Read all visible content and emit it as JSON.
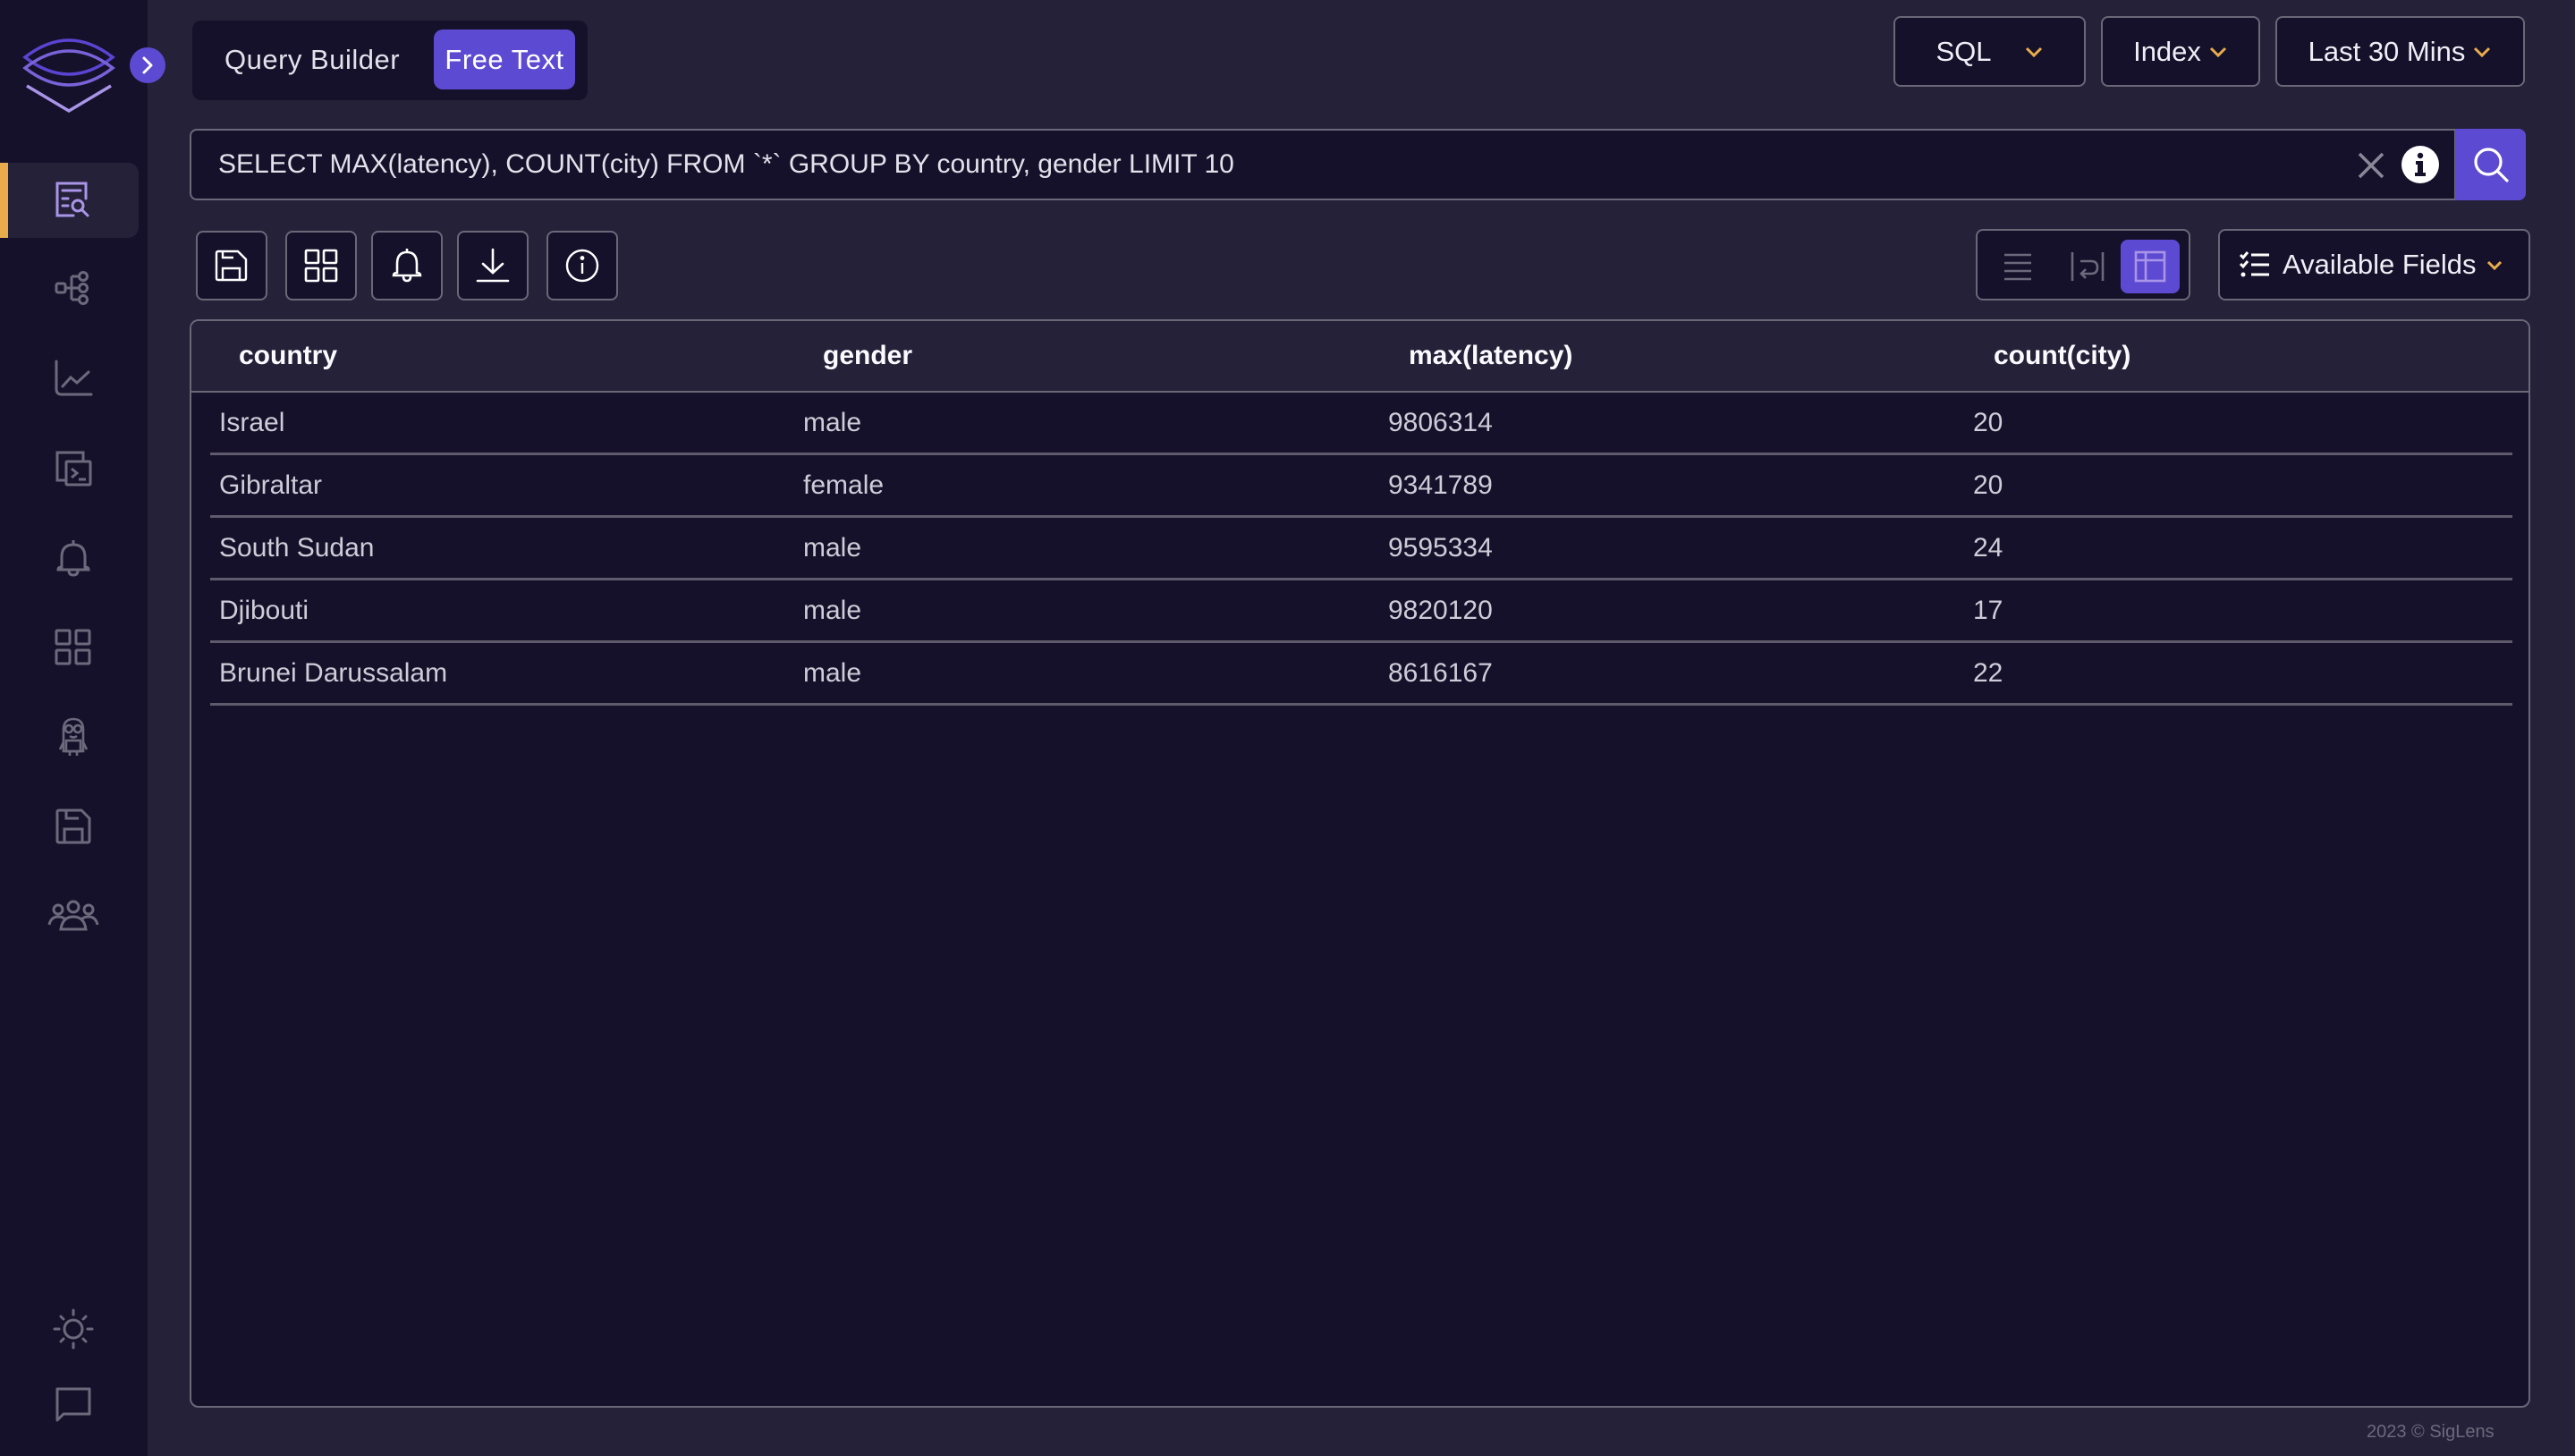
{
  "app": {
    "brand": "SigLens",
    "accent_color": "#5d4ad2",
    "highlight_color": "#e8ac4c"
  },
  "sidebar": {
    "collapse_icon": "chevron-right-icon",
    "items": [
      {
        "name": "logs-search",
        "icon": "log-search-icon",
        "active": true
      },
      {
        "name": "tracing",
        "icon": "hierarchy-icon",
        "active": false
      },
      {
        "name": "metrics",
        "icon": "line-chart-icon",
        "active": false
      },
      {
        "name": "live-tail",
        "icon": "terminal-icon",
        "active": false
      },
      {
        "name": "alerts",
        "icon": "bell-icon",
        "active": false
      },
      {
        "name": "dashboards",
        "icon": "grid-icon",
        "active": false
      },
      {
        "name": "minion-searches",
        "icon": "minion-icon",
        "active": false
      },
      {
        "name": "saved-queries",
        "icon": "save-icon",
        "active": false
      },
      {
        "name": "my-org",
        "icon": "users-icon",
        "active": false
      }
    ],
    "bottom_items": [
      {
        "name": "theme-toggle",
        "icon": "sun-icon"
      },
      {
        "name": "feedback",
        "icon": "chat-icon"
      }
    ]
  },
  "query_mode": {
    "tabs": [
      {
        "label": "Query Builder",
        "active": false
      },
      {
        "label": "Free Text",
        "active": true
      }
    ]
  },
  "header": {
    "language_dropdown": {
      "selected": "SQL"
    },
    "index_dropdown": {
      "selected": "Index"
    },
    "time_dropdown": {
      "selected": "Last 30 Mins"
    }
  },
  "query": {
    "value": "SELECT MAX(latency), COUNT(city) FROM `*` GROUP BY country, gender LIMIT 10"
  },
  "toolbar": {
    "buttons": [
      {
        "name": "save-query",
        "icon": "save-icon"
      },
      {
        "name": "add-to-dashboard",
        "icon": "grid-icon"
      },
      {
        "name": "create-alert",
        "icon": "bell-icon"
      },
      {
        "name": "download",
        "icon": "download-icon"
      },
      {
        "name": "query-info",
        "icon": "info-icon"
      }
    ],
    "view_modes": [
      {
        "name": "single-line",
        "icon": "list-icon",
        "active": false
      },
      {
        "name": "wrap-lines",
        "icon": "wrap-icon",
        "active": false
      },
      {
        "name": "table",
        "icon": "table-icon",
        "active": true
      }
    ],
    "available_fields_label": "Available Fields"
  },
  "results": {
    "columns": [
      "country",
      "gender",
      "max(latency)",
      "count(city)"
    ],
    "rows": [
      [
        "Israel",
        "male",
        "9806314",
        "20"
      ],
      [
        "Gibraltar",
        "female",
        "9341789",
        "20"
      ],
      [
        "South Sudan",
        "male",
        "9595334",
        "24"
      ],
      [
        "Djibouti",
        "male",
        "9820120",
        "17"
      ],
      [
        "Brunei Darussalam",
        "male",
        "8616167",
        "22"
      ]
    ]
  },
  "footer": {
    "text": "2023 © SigLens"
  }
}
